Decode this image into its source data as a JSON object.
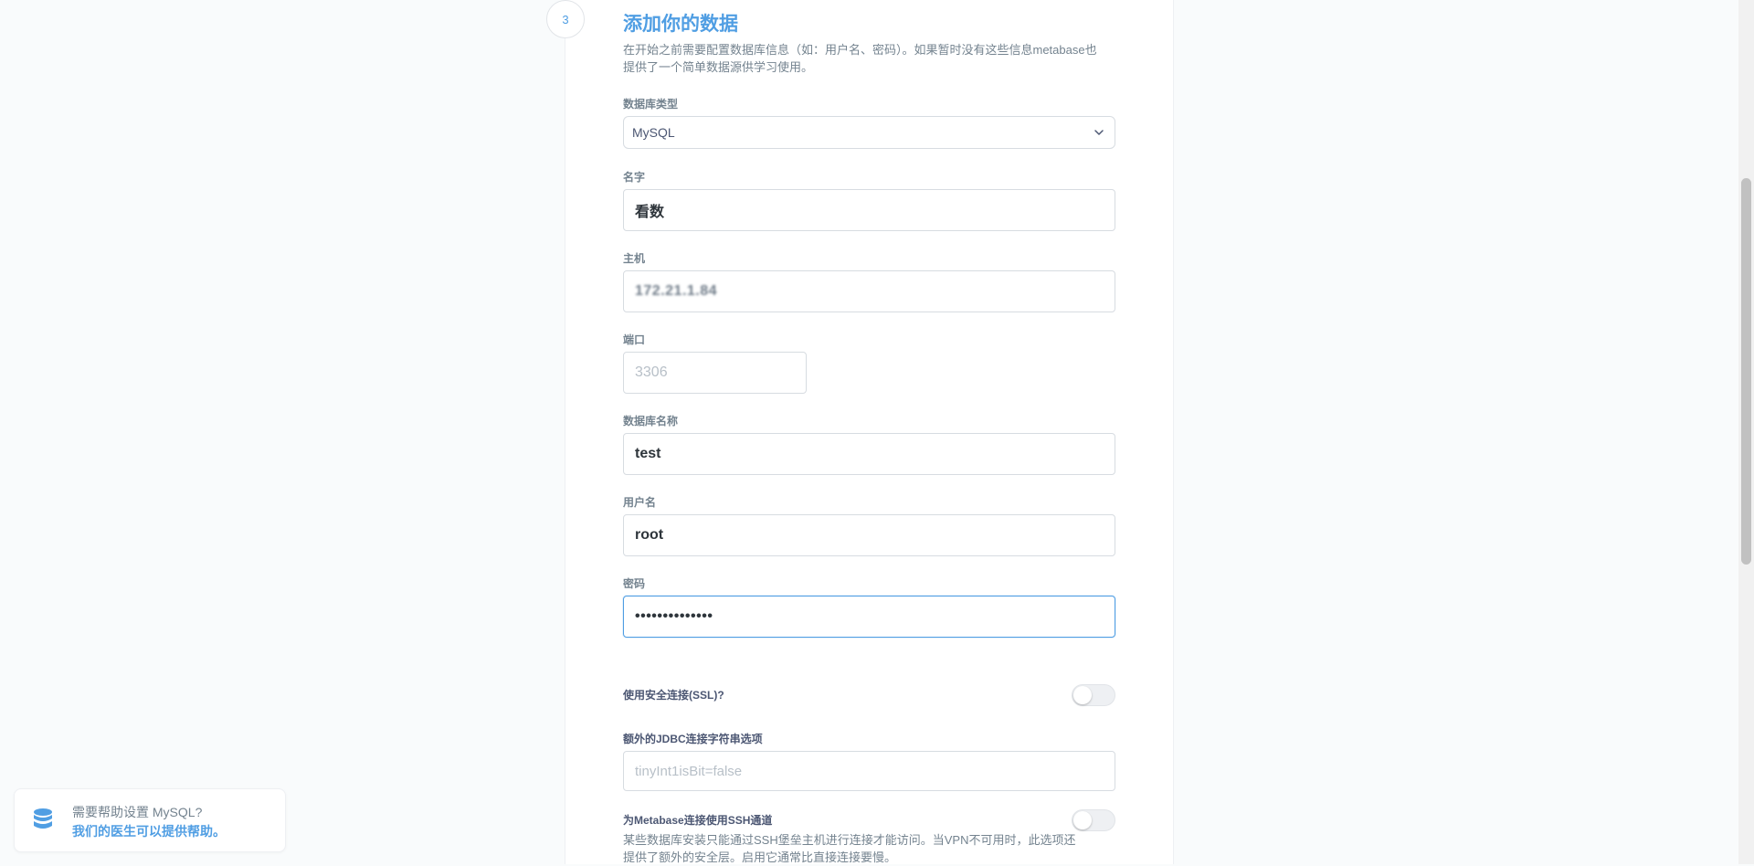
{
  "step": {
    "number": "3",
    "title": "添加你的数据",
    "description": "在开始之前需要配置数据库信息（如：用户名、密码）。如果暂时没有这些信息metabase也提供了一个简单数据源供学习使用。"
  },
  "form": {
    "db_type": {
      "label": "数据库类型",
      "value": "MySQL"
    },
    "name": {
      "label": "名字",
      "value": "看数"
    },
    "host": {
      "label": "主机",
      "value": "172.21.1.84"
    },
    "port": {
      "label": "端口",
      "placeholder": "3306"
    },
    "db_name": {
      "label": "数据库名称",
      "value": "test"
    },
    "username": {
      "label": "用户名",
      "value": "root"
    },
    "password": {
      "label": "密码",
      "value": "••••••••••••••"
    },
    "ssl": {
      "label": "使用安全连接(SSL)?",
      "enabled": false
    },
    "jdbc": {
      "label": "额外的JDBC连接字符串选项",
      "placeholder": "tinyInt1isBit=false"
    },
    "ssh": {
      "label": "为Metabase连接使用SSH通道",
      "enabled": false,
      "description": "某些数据库安装只能通过SSH堡垒主机进行连接才能访问。当VPN不可用时，此选项还提供了额外的安全层。启用它通常比直接连接要慢。"
    }
  },
  "help": {
    "line1": "需要帮助设置 MySQL?",
    "line2": "我们的医生可以提供帮助。"
  },
  "colors": {
    "accent": "#509ee3",
    "border": "#d7dce1",
    "text": "#2e353b",
    "muted": "#74838f"
  }
}
